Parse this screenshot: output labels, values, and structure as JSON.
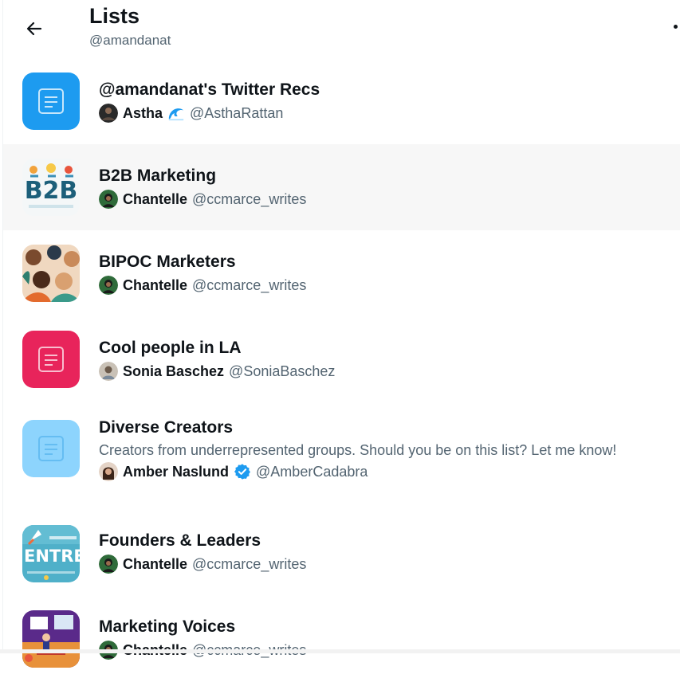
{
  "header": {
    "title": "Lists",
    "handle": "@amandanat",
    "back_icon": "arrow-left-icon",
    "more_icon": "more-dot-icon"
  },
  "colors": {
    "text_primary": "#0f1419",
    "text_secondary": "#536471",
    "blue": "#1d9bf0",
    "pink": "#e8245b",
    "light_blue": "#8dd4fd",
    "verified": "#1d9bf0",
    "hover_row": "#f7f7f7"
  },
  "lists": [
    {
      "name": "@amandanat's Twitter Recs",
      "owner_name": "Astha",
      "owner_handle": "@AsthaRattan",
      "thumb": "list-icon",
      "thumb_color": "#1d9bf0",
      "badge": "wave-icon"
    },
    {
      "name": "B2B Marketing",
      "owner_name": "Chantelle",
      "owner_handle": "@ccmarce_writes",
      "thumb": "b2b-image",
      "hovered": true
    },
    {
      "name": "BIPOC Marketers",
      "owner_name": "Chantelle",
      "owner_handle": "@ccmarce_writes",
      "thumb": "people-illustration-image"
    },
    {
      "name": "Cool people in LA",
      "owner_name": "Sonia Baschez",
      "owner_handle": "@SoniaBaschez",
      "thumb": "list-icon",
      "thumb_color": "#e8245b"
    },
    {
      "name": "Diverse Creators",
      "description": "Creators from underrepresented groups. Should you be on this list? Let me know!",
      "owner_name": "Amber Naslund",
      "owner_handle": "@AmberCadabra",
      "thumb": "list-icon",
      "thumb_color": "#8dd4fd",
      "badge": "verified-badge-icon"
    },
    {
      "name": "Founders & Leaders",
      "owner_name": "Chantelle",
      "owner_handle": "@ccmarce_writes",
      "thumb": "entrepreneur-image",
      "banner_text": "ENTRE"
    },
    {
      "name": "Marketing Voices",
      "owner_name": "Chantelle",
      "owner_handle": "@ccmarce_writes",
      "thumb": "presentation-illustration-image"
    }
  ]
}
